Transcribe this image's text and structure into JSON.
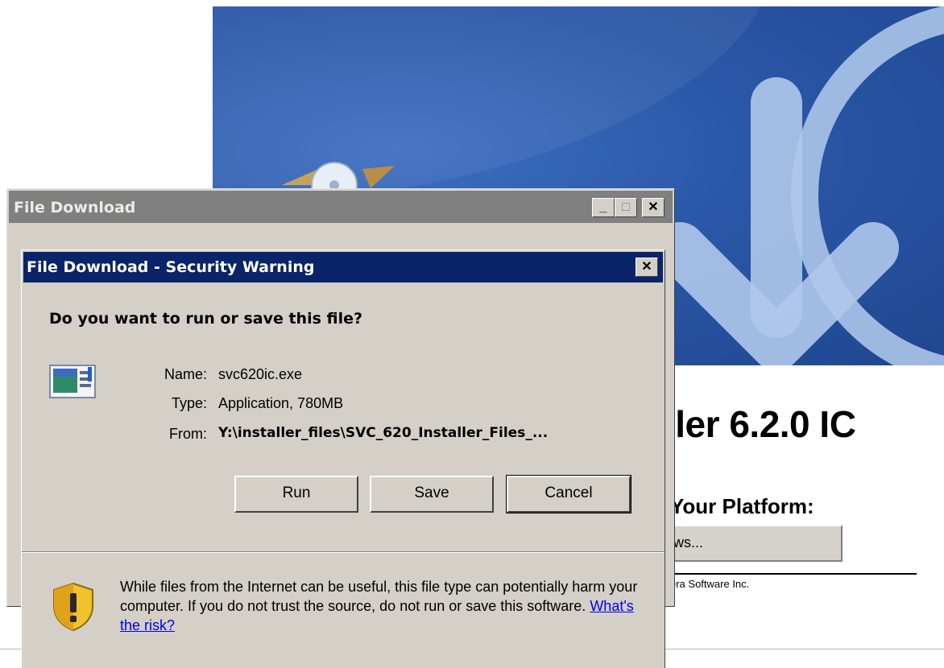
{
  "background": {
    "title": "ller 6.2.0 IC",
    "platform_label": "Your Platform:",
    "platform_button": "ws...",
    "copyright": "era Software Inc."
  },
  "outer_window": {
    "title": "File Download",
    "minimize": "_",
    "maximize": "□",
    "close": "✕"
  },
  "dialog": {
    "title": "File Download - Security Warning",
    "close": "✕",
    "question": "Do you want to run or save this file?",
    "file": {
      "name_label": "Name:",
      "name": "svc620ic.exe",
      "type_label": "Type:",
      "type": "Application, 780MB",
      "from_label": "From:",
      "from": "Y:\\installer_files\\SVC_620_Installer_Files_..."
    },
    "buttons": {
      "run": "Run",
      "save": "Save",
      "cancel": "Cancel"
    },
    "warning": {
      "text": "While files from the Internet can be useful, this file type can potentially harm your computer. If you do not trust the source, do not run or save this software. ",
      "link": "What's the risk?"
    }
  },
  "colors": {
    "dialog_titlebar": "#0a246a",
    "inactive_titlebar": "#808080",
    "face": "#d4d0c8",
    "banner": "#2a58a8"
  }
}
